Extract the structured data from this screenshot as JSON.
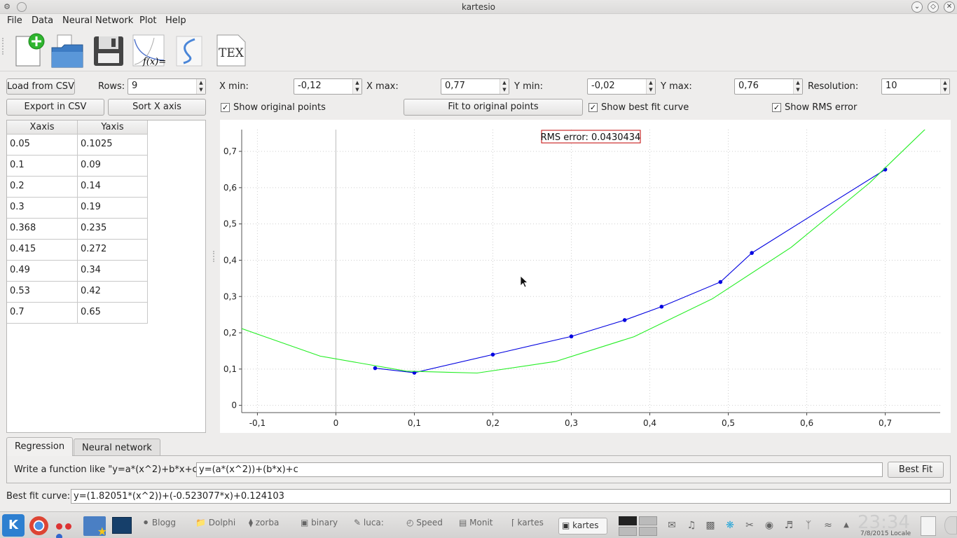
{
  "window": {
    "title": "kartesio"
  },
  "menu": [
    "File",
    "Data",
    "Neural Network",
    "Plot",
    "Help"
  ],
  "toolbar": {
    "tools": [
      "new-document-icon",
      "open-folder-icon",
      "save-icon",
      "function-fx-icon",
      "curve-icon",
      "tex-icon"
    ],
    "fx_text": "f(x)=",
    "tex_text": "TEX"
  },
  "controls": {
    "load_csv": "Load from CSV",
    "rows_label": "Rows:",
    "rows_value": "9",
    "export_csv": "Export in CSV",
    "sort_x": "Sort X axis",
    "xmin_label": "X min:",
    "xmin_value": "-0,12",
    "xmax_label": "X max:",
    "xmax_value": "0,77",
    "ymin_label": "Y min:",
    "ymin_value": "-0,02",
    "ymax_label": "Y max:",
    "ymax_value": "0,76",
    "resolution_label": "Resolution:",
    "resolution_value": "10",
    "show_original": "Show original points",
    "fit_original": "Fit to original points",
    "show_best": "Show best fit curve",
    "show_rms": "Show RMS error"
  },
  "table": {
    "headers": [
      "Xaxis",
      "Yaxis"
    ],
    "rows": [
      [
        "0.05",
        "0.1025"
      ],
      [
        "0.1",
        "0.09"
      ],
      [
        "0.2",
        "0.14"
      ],
      [
        "0.3",
        "0.19"
      ],
      [
        "0.368",
        "0.235"
      ],
      [
        "0.415",
        "0.272"
      ],
      [
        "0.49",
        "0.34"
      ],
      [
        "0.53",
        "0.42"
      ],
      [
        "0.7",
        "0.65"
      ]
    ]
  },
  "chart_data": {
    "type": "line",
    "title": "",
    "xlabel": "",
    "ylabel": "",
    "xlim": [
      -0.12,
      0.77
    ],
    "ylim": [
      -0.02,
      0.76
    ],
    "x_ticks": [
      "-0,1",
      "0",
      "0,1",
      "0,2",
      "0,3",
      "0,4",
      "0,5",
      "0,6",
      "0,7"
    ],
    "x_tick_values": [
      -0.1,
      0,
      0.1,
      0.2,
      0.3,
      0.4,
      0.5,
      0.6,
      0.7
    ],
    "y_ticks": [
      "0",
      "0,1",
      "0,2",
      "0,3",
      "0,4",
      "0,5",
      "0,6",
      "0,7"
    ],
    "y_tick_values": [
      0,
      0.1,
      0.2,
      0.3,
      0.4,
      0.5,
      0.6,
      0.7
    ],
    "grid": true,
    "annotation": "RMS error: 0.0430434",
    "series": [
      {
        "color": "#0000e0",
        "markers": true,
        "x": [
          0.05,
          0.1,
          0.2,
          0.3,
          0.368,
          0.415,
          0.49,
          0.53,
          0.7
        ],
        "y": [
          0.1025,
          0.09,
          0.14,
          0.19,
          0.235,
          0.272,
          0.34,
          0.42,
          0.65
        ]
      },
      {
        "color": "#22ee22",
        "markers": false,
        "x": [
          -0.12,
          -0.02,
          0.09,
          0.18,
          0.28,
          0.38,
          0.48,
          0.58,
          0.68,
          0.77
        ],
        "y": [
          0.2116,
          0.1357,
          0.0942,
          0.0891,
          0.121,
          0.1893,
          0.2941,
          0.4353,
          0.613,
          0.8009
        ]
      }
    ]
  },
  "tabs": {
    "items": [
      "Regression",
      "Neural network"
    ],
    "active": 0,
    "write_label": "Write a function like \"y=a*(x^2)+b*x+c\":",
    "function_value": "y=(a*(x^2))+(b*x)+c",
    "best_fit_btn": "Best Fit"
  },
  "bestfit": {
    "label": "Best fit curve:",
    "value": "y=(1.82051*(x^2))+(-0.523077*x)+0.124103"
  },
  "taskbar": {
    "tasks": [
      "Blogg",
      "Dolphi",
      "zorba",
      "binary",
      "luca:",
      "Speed",
      "Monit",
      "kartes",
      "kartes"
    ],
    "clock": "23:34",
    "date": "7/8/2015 Locale"
  }
}
